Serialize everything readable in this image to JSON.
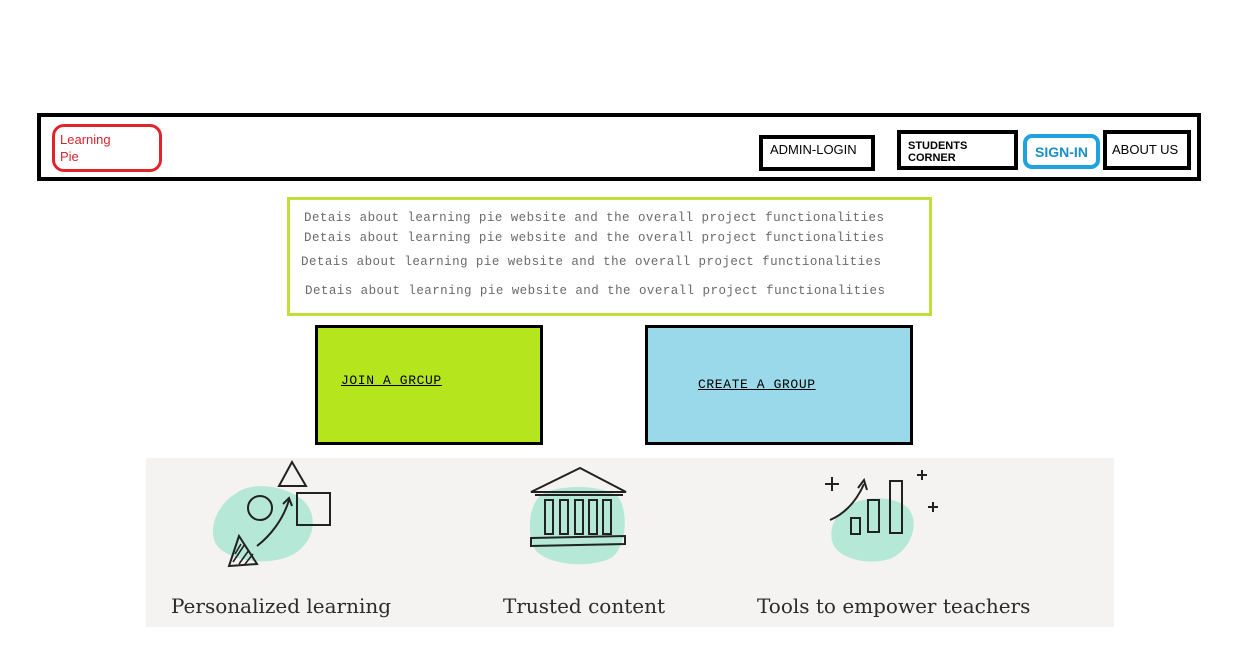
{
  "header": {
    "logo_line1": "Learning",
    "logo_line2": "Pie",
    "nav": {
      "admin_login": "ADMIN-LOGIN",
      "students_corner": "STUDENTS CORNER",
      "sign_in": "SIGN-IN",
      "about_us": "ABOUT US"
    }
  },
  "description": {
    "lines": [
      "Detais about learning pie website and the overall project functionalities",
      "Detais about learning pie website and the overall project functionalities",
      "Detais about learning pie website and the overall project functionalities",
      "Detais about learning pie website and the overall project functionalities"
    ]
  },
  "groups": {
    "join_label": "JOIN A GRCUP",
    "create_label": "CREATE A GROUP"
  },
  "features": {
    "items": [
      {
        "title": "Personalized learning",
        "icon": "shapes-growth-icon"
      },
      {
        "title": "Trusted content",
        "icon": "institution-building-icon"
      },
      {
        "title": "Tools to empower teachers",
        "icon": "bar-chart-growth-icon"
      }
    ]
  },
  "colors": {
    "logo_red": "#e0242b",
    "signin_blue": "#1fa3e0",
    "desc_border": "#bfe03a",
    "join_bg": "#b5e61d",
    "create_bg": "#99d9ea",
    "features_bg": "#f4f3f1",
    "illustration_mint": "#b5e8d6"
  }
}
